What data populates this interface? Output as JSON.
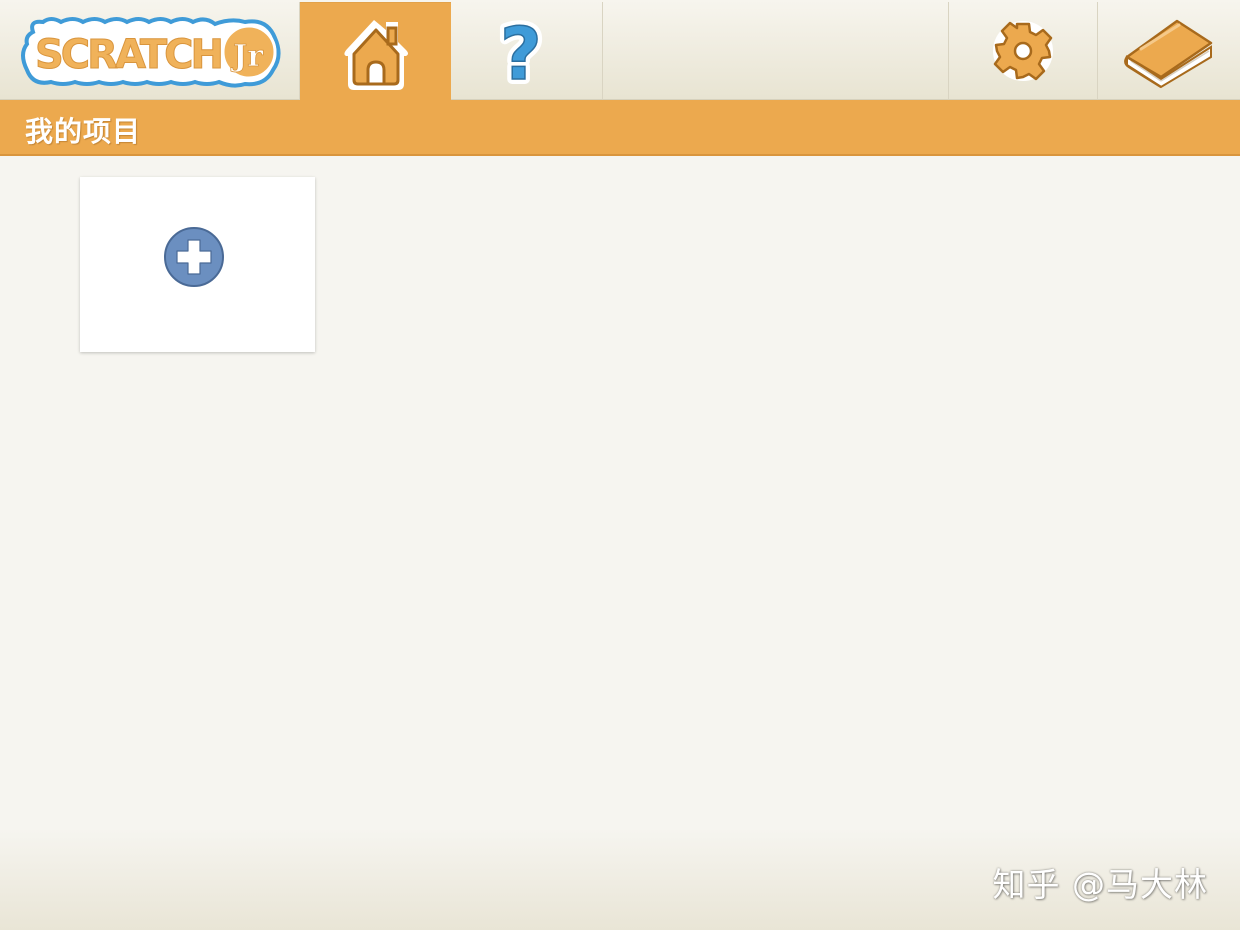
{
  "app": {
    "logo_text": "SCRATCH Jr",
    "logo_icon": "scratchjr-logo"
  },
  "toolbar": {
    "tabs": [
      {
        "name": "home",
        "icon": "home-icon",
        "selected": true
      },
      {
        "name": "help",
        "icon": "question-mark-icon",
        "selected": false
      },
      {
        "name": "settings",
        "icon": "gear-icon",
        "selected": false
      },
      {
        "name": "guide",
        "icon": "book-icon",
        "selected": false
      }
    ]
  },
  "header": {
    "title": "我的项目"
  },
  "projects": {
    "new_project_icon": "plus-circle-icon"
  },
  "watermark": {
    "text": "知乎 @马大林"
  },
  "colors": {
    "accent_orange": "#eca94e",
    "logo_blue": "#3f9bd8",
    "plus_blue": "#6b8fc0",
    "background": "#f6f5f0"
  }
}
